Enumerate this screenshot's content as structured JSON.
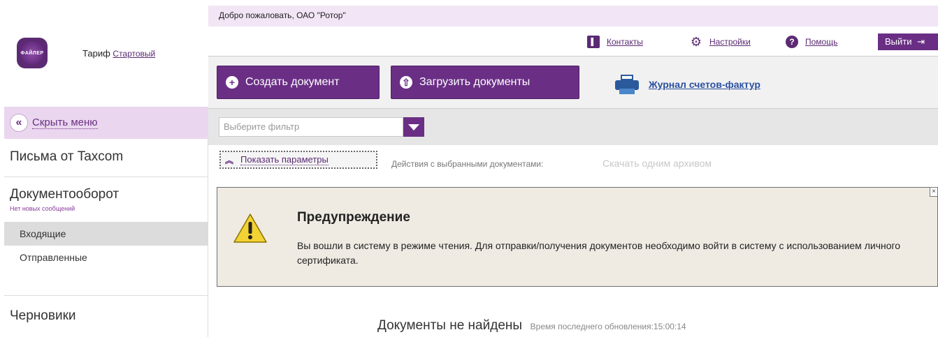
{
  "sidebar": {
    "tariff_label": "Тариф",
    "tariff_link": "Стартовый",
    "logo_text": "ФАЙЛЕР",
    "hide_menu": "Скрыть меню",
    "sections": [
      {
        "title": "Письма от Taxcom"
      },
      {
        "title": "Документооборот",
        "subtitle": "Нет новых сообщений",
        "items": [
          "Входящие",
          "Отправленные"
        ]
      },
      {
        "title": "Черновики"
      }
    ]
  },
  "header": {
    "welcome": "Добро пожаловать, ОАО \"Ротор\"",
    "links": {
      "contacts": "Контакты",
      "settings": "Настройки",
      "help": "Помощь"
    },
    "logout": "Выйти"
  },
  "toolbar": {
    "create": "Создать документ",
    "upload": "Загрузить документы",
    "journal": "Журнал счетов-фактур"
  },
  "filter": {
    "placeholder": "Выберите фильтр"
  },
  "params": {
    "show_params": "Показать параметры",
    "actions_label": "Действия с выбранными документами:",
    "download_archive": "Скачать одним архивом"
  },
  "warning": {
    "title": "Предупреждение",
    "text": "Вы вошли в систему в режиме чтения. Для отправки/получения документов необходимо войти в систему с использованием личного сертификата."
  },
  "empty": {
    "message": "Документы не найдены",
    "updated": "Время последнего обновления:15:00:14"
  },
  "colors": {
    "brand": "#6a2f85",
    "accent_light": "#ead7ef",
    "link": "#2a4fa0"
  }
}
